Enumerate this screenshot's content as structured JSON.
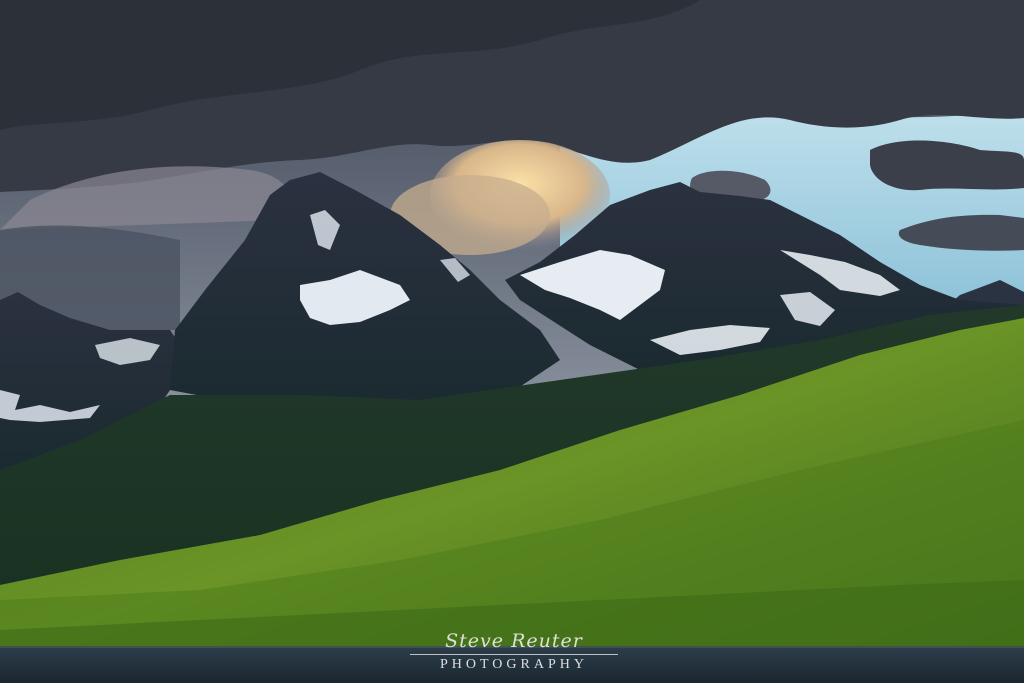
{
  "photo": {
    "subject": "landscape-photograph",
    "colors": {
      "sky": "#3a4a5c",
      "clear_sky": "#a9d2e4",
      "storm_cloud": "#2f343d",
      "sunlit_cloud": "#f1c98a",
      "peak_rock": "#262d3a",
      "snow": "#e9eef4",
      "forest_shadow": "#1d3524",
      "forest_sunlit": "#5e8a22",
      "lake": "#23333f"
    }
  },
  "watermark": {
    "signature": "Steve Reuter",
    "caption": "PHOTOGRAPHY"
  }
}
